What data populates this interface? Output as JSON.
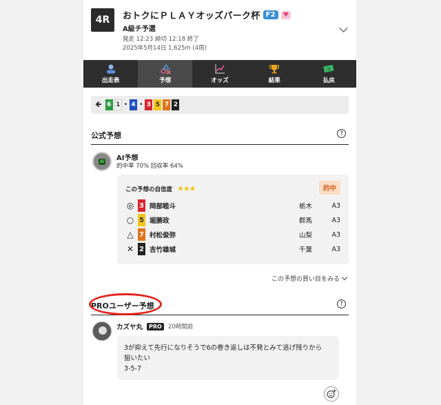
{
  "race": {
    "number": "4R",
    "title": "おトクにＰＬＡＹオッズパーク杯",
    "grade": "F2",
    "heart": "♥",
    "subtitle": "A級チ予選",
    "schedule": "発走 12:23 締切 12:18 終了",
    "date_line": "2025年5月14日 1,625m (4周)"
  },
  "nav": [
    {
      "label": "出走表",
      "icon": "person-icon"
    },
    {
      "label": "予想",
      "icon": "prediction-shapes-icon"
    },
    {
      "label": "オッズ",
      "icon": "chart-icon"
    },
    {
      "label": "結果",
      "icon": "trophy-icon"
    },
    {
      "label": "払戻",
      "icon": "money-icon"
    }
  ],
  "result_order": {
    "arrow": "🡸",
    "groups": [
      [
        "6",
        "1"
      ],
      [
        "4"
      ],
      [
        "3",
        "5",
        "7",
        "2"
      ]
    ]
  },
  "official": {
    "heading": "公式予想",
    "help": "?",
    "ai": {
      "avatar_text": "AI",
      "name": "AI予想",
      "stats": "的中率 70%  回収率 64%"
    },
    "confidence_label": "この予想の自信度",
    "stars": "★★★",
    "hit_badge": "的中",
    "picks": [
      {
        "mark": "◎",
        "num": "3",
        "color": "#d8262f",
        "name": "岡部睦斗",
        "location": "栃木",
        "class": "A3"
      },
      {
        "mark": "○",
        "num": "5",
        "color": "#f3c61a",
        "name": "堀勝政",
        "location": "群馬",
        "class": "A3"
      },
      {
        "mark": "△",
        "num": "7",
        "color": "#e0731b",
        "name": "村松俊弥",
        "location": "山梨",
        "class": "A3"
      },
      {
        "mark": "✕",
        "num": "2",
        "color": "#222222",
        "name": "吉竹雄城",
        "location": "千葉",
        "class": "A3"
      }
    ],
    "more_link": "この予想の買い目をみる"
  },
  "pro": {
    "heading": "PROユーザー予想",
    "help": "?",
    "user": "カズヤ丸",
    "badge": "PRO",
    "time": "20時間前",
    "comment_line1": "3が抑えて先行になりそうで6の巻き返しは不発とみて逃げ残りから",
    "comment_line2": "狙いたい",
    "comment_line3": "3-5-7",
    "reaction_icon": "smile-plus-icon"
  }
}
